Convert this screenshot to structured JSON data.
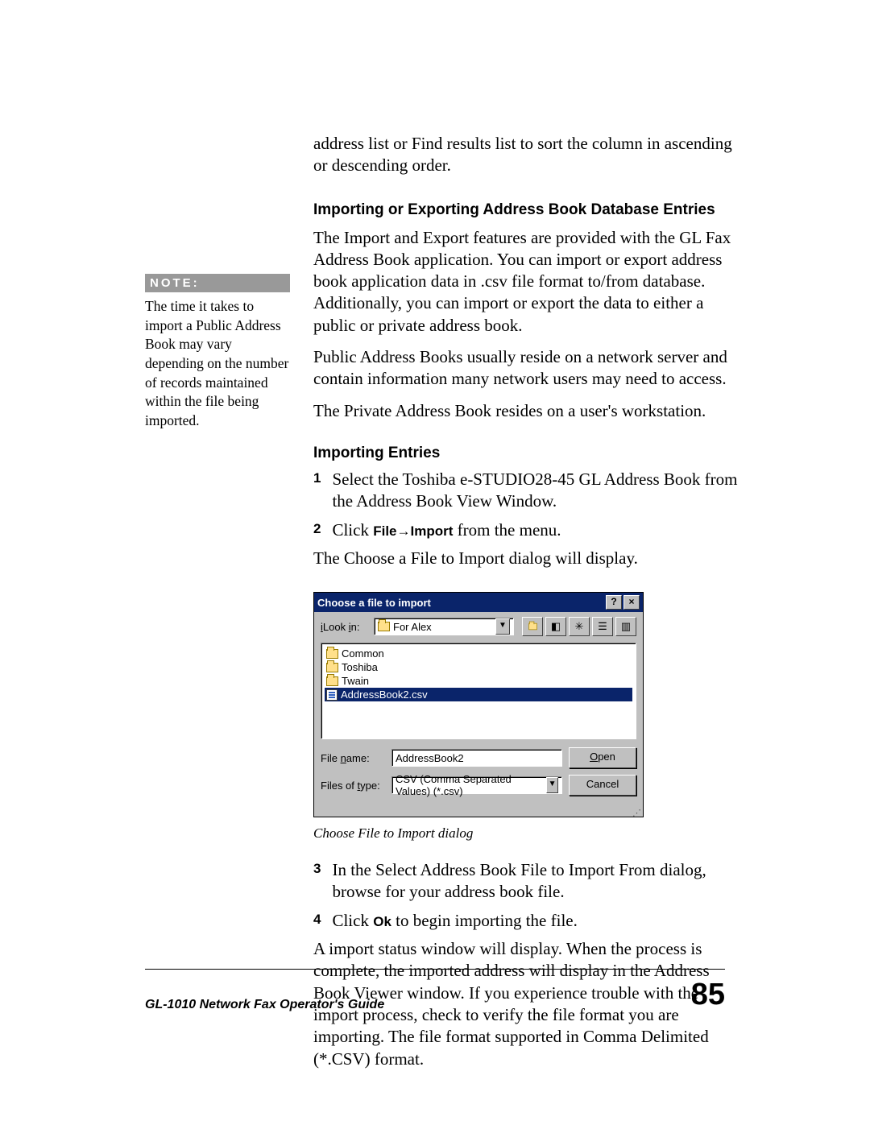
{
  "intro_para": "address list or Find results list to sort the column in ascending or descending order.",
  "h_import_export": "Importing or Exporting Address Book Database Entries",
  "p_import_export1": "The Import and Export features are provided with the GL Fax Address Book application. You can import or export address book application data in .csv file format to/from database. Additionally, you can import or export the data to either a public or private address book.",
  "p_public": "Public Address Books usually reside on a network server and contain information many network users may need to access.",
  "p_private": "The Private Address Book resides on a user's workstation.",
  "h_importing": "Importing Entries",
  "step1_num": "1",
  "step1_text": "Select the Toshiba e-STUDIO28-45 GL Address Book from the Address Book View Window.",
  "step2_num": "2",
  "step2_prefix": "Click ",
  "step2_ui": "File→Import",
  "step2_suffix": " from the menu.",
  "p_choose_dialog": "The Choose a File to Import dialog will display.",
  "dialog": {
    "title": "Choose a file to import",
    "help_btn": "?",
    "close_btn": "×",
    "lookin_label": "Look in:",
    "lookin_value": "For Alex",
    "files": {
      "f1": "Common",
      "f2": "Toshiba",
      "f3": "Twain",
      "f4": "AddressBook2.csv"
    },
    "filename_label": "File name:",
    "filename_value": "AddressBook2",
    "filetype_label": "Files of type:",
    "filetype_value": "CSV (Comma Separated Values) (*.csv)",
    "open_btn_pre": "O",
    "open_btn_post": "pen",
    "cancel_btn": "Cancel"
  },
  "caption": "Choose File to Import dialog",
  "step3_num": "3",
  "step3_text": "In the Select Address Book File to Import From dialog, browse for your address book file.",
  "step4_num": "4",
  "step4_prefix": "Click ",
  "step4_ui": "Ok",
  "step4_suffix": " to begin importing the file.",
  "p_after": "A import status window will display. When the process is complete, the imported address will display in the Address Book Viewer window. If you experience trouble with the import process, check to verify the file format you are importing. The file format supported in Comma Delimited (*.CSV) format.",
  "note": {
    "label": "NOTE:",
    "text": "The time it takes to import a Public Address Book may vary depending on the number of records maintained within the file being imported."
  },
  "footer": {
    "left": "GL-1010 Network Fax Operator's Guide",
    "page": "85"
  }
}
